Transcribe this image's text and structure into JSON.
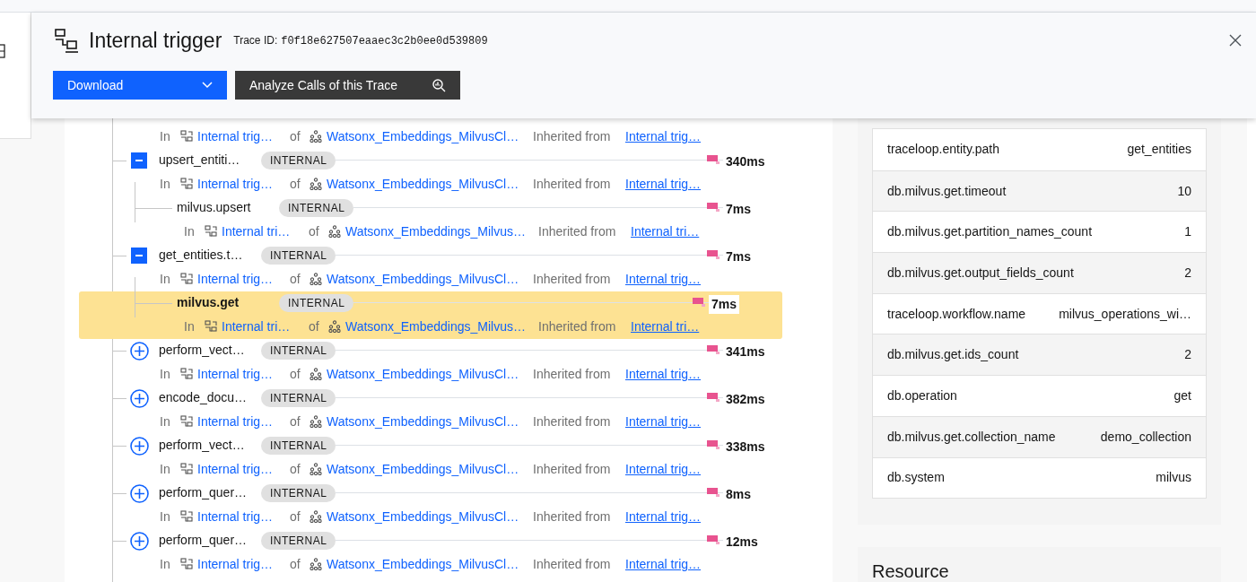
{
  "header": {
    "title": "Internal trigger",
    "trace_id_label": "Trace ID:",
    "trace_id": "f0f18e627507eaaec3c2b0ee0d539809",
    "buttons": [
      {
        "kind": "dropdown",
        "label": "Download"
      },
      {
        "kind": "analyze",
        "label": "Analyze Calls of this Trace"
      }
    ]
  },
  "trace": {
    "spans": [
      {
        "info": {
          "in": "In",
          "service": "Internal trig…",
          "of": "of",
          "app": "Watsonx_Embeddings_MilvusCl…",
          "inherited": "Inherited from",
          "link": "Internal trig…"
        }
      },
      {
        "name": "upsert_entiti…",
        "badge": "INTERNAL",
        "duration": "340ms",
        "expanded": true,
        "selected": false,
        "info": {
          "in": "In",
          "service": "Internal trig…",
          "of": "of",
          "app": "Watsonx_Embeddings_MilvusCl…",
          "inherited": "Inherited from",
          "link": "Internal trig…"
        },
        "children": [
          {
            "name": "milvus.upsert",
            "badge": "INTERNAL",
            "duration": "7ms",
            "selected": false,
            "info": {
              "in": "In",
              "service": "Internal tri…",
              "of": "of",
              "app": "Watsonx_Embeddings_Milvus…",
              "inherited": "Inherited from",
              "link": "Internal tri…"
            }
          }
        ]
      },
      {
        "name": "get_entities.t…",
        "badge": "INTERNAL",
        "duration": "7ms",
        "expanded": true,
        "selected": false,
        "info": {
          "in": "In",
          "service": "Internal trig…",
          "of": "of",
          "app": "Watsonx_Embeddings_MilvusCl…",
          "inherited": "Inherited from",
          "link": "Internal trig…"
        },
        "children": [
          {
            "name": "milvus.get",
            "badge": "INTERNAL",
            "duration": "7ms",
            "selected": true,
            "info": {
              "in": "In",
              "service": "Internal tri…",
              "of": "of",
              "app": "Watsonx_Embeddings_Milvus…",
              "inherited": "Inherited from",
              "link": "Internal tri…"
            }
          }
        ]
      },
      {
        "name": "perform_vect…",
        "badge": "INTERNAL",
        "duration": "341ms",
        "expanded": false,
        "selected": false,
        "info": {
          "in": "In",
          "service": "Internal trig…",
          "of": "of",
          "app": "Watsonx_Embeddings_MilvusCl…",
          "inherited": "Inherited from",
          "link": "Internal trig…"
        }
      },
      {
        "name": "encode_docu…",
        "badge": "INTERNAL",
        "duration": "382ms",
        "expanded": false,
        "selected": false,
        "info": {
          "in": "In",
          "service": "Internal trig…",
          "of": "of",
          "app": "Watsonx_Embeddings_MilvusCl…",
          "inherited": "Inherited from",
          "link": "Internal trig…"
        }
      },
      {
        "name": "perform_vect…",
        "badge": "INTERNAL",
        "duration": "338ms",
        "expanded": false,
        "selected": false,
        "info": {
          "in": "In",
          "service": "Internal trig…",
          "of": "of",
          "app": "Watsonx_Embeddings_MilvusCl…",
          "inherited": "Inherited from",
          "link": "Internal trig…"
        }
      },
      {
        "name": "perform_quer…",
        "badge": "INTERNAL",
        "duration": "8ms",
        "expanded": false,
        "selected": false,
        "info": {
          "in": "In",
          "service": "Internal trig…",
          "of": "of",
          "app": "Watsonx_Embeddings_MilvusCl…",
          "inherited": "Inherited from",
          "link": "Internal trig…"
        }
      },
      {
        "name": "perform_quer…",
        "badge": "INTERNAL",
        "duration": "12ms",
        "expanded": false,
        "selected": false,
        "info": {
          "in": "In",
          "service": "Internal trig…",
          "of": "of",
          "app": "Watsonx_Embeddings_MilvusCl…",
          "inherited": "Inherited from",
          "link": "Internal trig…"
        }
      }
    ]
  },
  "attributes": [
    {
      "key": "traceloop.entity.path",
      "value": "get_entities"
    },
    {
      "key": "db.milvus.get.timeout",
      "value": "10"
    },
    {
      "key": "db.milvus.get.partition_names_count",
      "value": "1"
    },
    {
      "key": "db.milvus.get.output_fields_count",
      "value": "2"
    },
    {
      "key": "traceloop.workflow.name",
      "value": "milvus_operations_wi…"
    },
    {
      "key": "db.milvus.get.ids_count",
      "value": "2"
    },
    {
      "key": "db.operation",
      "value": "get"
    },
    {
      "key": "db.milvus.get.collection_name",
      "value": "demo_collection"
    },
    {
      "key": "db.system",
      "value": "milvus"
    }
  ],
  "resource": {
    "title": "Resource"
  }
}
